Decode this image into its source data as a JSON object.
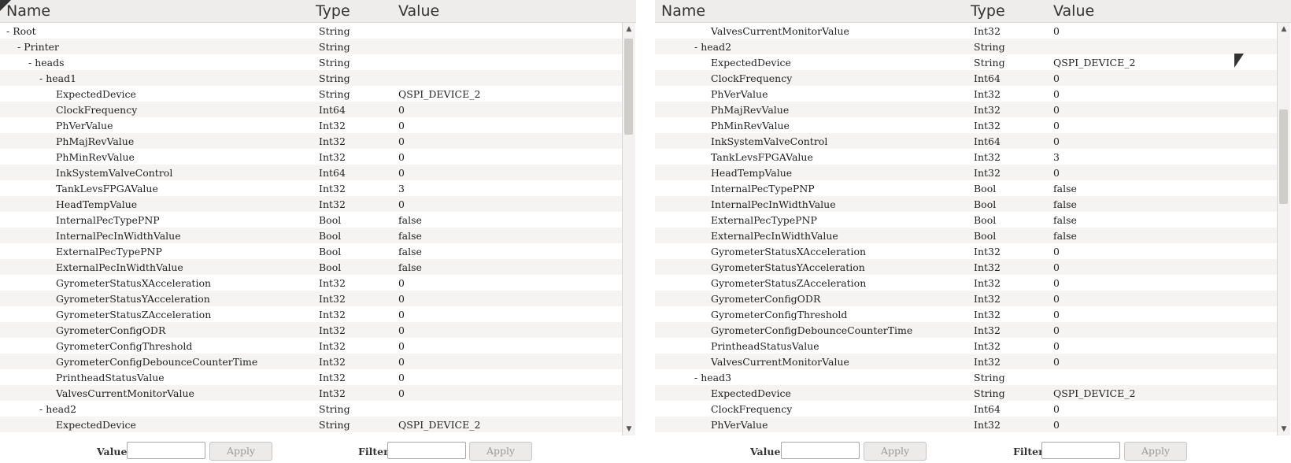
{
  "panels": [
    {
      "columns": {
        "name": "Name",
        "type": "Type",
        "value": "Value"
      },
      "rows": [
        {
          "label": "- Root",
          "indent": 0,
          "type": "String",
          "value": ""
        },
        {
          "label": "- Printer",
          "indent": 1,
          "type": "String",
          "value": ""
        },
        {
          "label": "- heads",
          "indent": 2,
          "type": "String",
          "value": ""
        },
        {
          "label": "- head1",
          "indent": 3,
          "type": "String",
          "value": ""
        },
        {
          "label": "ExpectedDevice",
          "indent": 4,
          "type": "String",
          "value": "QSPI_DEVICE_2"
        },
        {
          "label": "ClockFrequency",
          "indent": 4,
          "type": "Int64",
          "value": "0"
        },
        {
          "label": "PhVerValue",
          "indent": 4,
          "type": "Int32",
          "value": "0"
        },
        {
          "label": "PhMajRevValue",
          "indent": 4,
          "type": "Int32",
          "value": "0"
        },
        {
          "label": "PhMinRevValue",
          "indent": 4,
          "type": "Int32",
          "value": "0"
        },
        {
          "label": "InkSystemValveControl",
          "indent": 4,
          "type": "Int64",
          "value": "0"
        },
        {
          "label": "TankLevsFPGAValue",
          "indent": 4,
          "type": "Int32",
          "value": "3"
        },
        {
          "label": "HeadTempValue",
          "indent": 4,
          "type": "Int32",
          "value": "0"
        },
        {
          "label": "InternalPecTypePNP",
          "indent": 4,
          "type": "Bool",
          "value": "false"
        },
        {
          "label": "InternalPecInWidthValue",
          "indent": 4,
          "type": "Bool",
          "value": "false"
        },
        {
          "label": "ExternalPecTypePNP",
          "indent": 4,
          "type": "Bool",
          "value": "false"
        },
        {
          "label": "ExternalPecInWidthValue",
          "indent": 4,
          "type": "Bool",
          "value": "false"
        },
        {
          "label": "GyrometerStatusXAcceleration",
          "indent": 4,
          "type": "Int32",
          "value": "0"
        },
        {
          "label": "GyrometerStatusYAcceleration",
          "indent": 4,
          "type": "Int32",
          "value": "0"
        },
        {
          "label": "GyrometerStatusZAcceleration",
          "indent": 4,
          "type": "Int32",
          "value": "0"
        },
        {
          "label": "GyrometerConfigODR",
          "indent": 4,
          "type": "Int32",
          "value": "0"
        },
        {
          "label": "GyrometerConfigThreshold",
          "indent": 4,
          "type": "Int32",
          "value": "0"
        },
        {
          "label": "GyrometerConfigDebounceCounterTime",
          "indent": 4,
          "type": "Int32",
          "value": "0"
        },
        {
          "label": "PrintheadStatusValue",
          "indent": 4,
          "type": "Int32",
          "value": "0"
        },
        {
          "label": "ValvesCurrentMonitorValue",
          "indent": 4,
          "type": "Int32",
          "value": "0"
        },
        {
          "label": "- head2",
          "indent": 3,
          "type": "String",
          "value": ""
        },
        {
          "label": "ExpectedDevice",
          "indent": 4,
          "type": "String",
          "value": "QSPI_DEVICE_2"
        }
      ],
      "footer": {
        "value_label": "Value:",
        "value_input": "",
        "value_apply": "Apply",
        "filter_label": "Filter:",
        "filter_input": "",
        "filter_apply": "Apply"
      }
    },
    {
      "columns": {
        "name": "Name",
        "type": "Type",
        "value": "Value"
      },
      "rows": [
        {
          "label": "ValvesCurrentMonitorValue",
          "indent": 4,
          "type": "Int32",
          "value": "0"
        },
        {
          "label": "- head2",
          "indent": 3,
          "type": "String",
          "value": ""
        },
        {
          "label": "ExpectedDevice",
          "indent": 4,
          "type": "String",
          "value": "QSPI_DEVICE_2"
        },
        {
          "label": "ClockFrequency",
          "indent": 4,
          "type": "Int64",
          "value": "0"
        },
        {
          "label": "PhVerValue",
          "indent": 4,
          "type": "Int32",
          "value": "0"
        },
        {
          "label": "PhMajRevValue",
          "indent": 4,
          "type": "Int32",
          "value": "0"
        },
        {
          "label": "PhMinRevValue",
          "indent": 4,
          "type": "Int32",
          "value": "0"
        },
        {
          "label": "InkSystemValveControl",
          "indent": 4,
          "type": "Int64",
          "value": "0"
        },
        {
          "label": "TankLevsFPGAValue",
          "indent": 4,
          "type": "Int32",
          "value": "3"
        },
        {
          "label": "HeadTempValue",
          "indent": 4,
          "type": "Int32",
          "value": "0"
        },
        {
          "label": "InternalPecTypePNP",
          "indent": 4,
          "type": "Bool",
          "value": "false"
        },
        {
          "label": "InternalPecInWidthValue",
          "indent": 4,
          "type": "Bool",
          "value": "false"
        },
        {
          "label": "ExternalPecTypePNP",
          "indent": 4,
          "type": "Bool",
          "value": "false"
        },
        {
          "label": "ExternalPecInWidthValue",
          "indent": 4,
          "type": "Bool",
          "value": "false"
        },
        {
          "label": "GyrometerStatusXAcceleration",
          "indent": 4,
          "type": "Int32",
          "value": "0"
        },
        {
          "label": "GyrometerStatusYAcceleration",
          "indent": 4,
          "type": "Int32",
          "value": "0"
        },
        {
          "label": "GyrometerStatusZAcceleration",
          "indent": 4,
          "type": "Int32",
          "value": "0"
        },
        {
          "label": "GyrometerConfigODR",
          "indent": 4,
          "type": "Int32",
          "value": "0"
        },
        {
          "label": "GyrometerConfigThreshold",
          "indent": 4,
          "type": "Int32",
          "value": "0"
        },
        {
          "label": "GyrometerConfigDebounceCounterTime",
          "indent": 4,
          "type": "Int32",
          "value": "0"
        },
        {
          "label": "PrintheadStatusValue",
          "indent": 4,
          "type": "Int32",
          "value": "0"
        },
        {
          "label": "ValvesCurrentMonitorValue",
          "indent": 4,
          "type": "Int32",
          "value": "0"
        },
        {
          "label": "- head3",
          "indent": 3,
          "type": "String",
          "value": ""
        },
        {
          "label": "ExpectedDevice",
          "indent": 4,
          "type": "String",
          "value": "QSPI_DEVICE_2"
        },
        {
          "label": "ClockFrequency",
          "indent": 4,
          "type": "Int64",
          "value": "0"
        },
        {
          "label": "PhVerValue",
          "indent": 4,
          "type": "Int32",
          "value": "0"
        }
      ],
      "footer": {
        "value_label": "Value:",
        "value_input": "",
        "value_apply": "Apply",
        "filter_label": "Filter:",
        "filter_input": "",
        "filter_apply": "Apply"
      }
    }
  ],
  "scrollbar": {
    "up_icon": "arrow-up-icon",
    "down_icon": "arrow-down-icon"
  },
  "cursor_icon": "mouse-pointer-icon"
}
